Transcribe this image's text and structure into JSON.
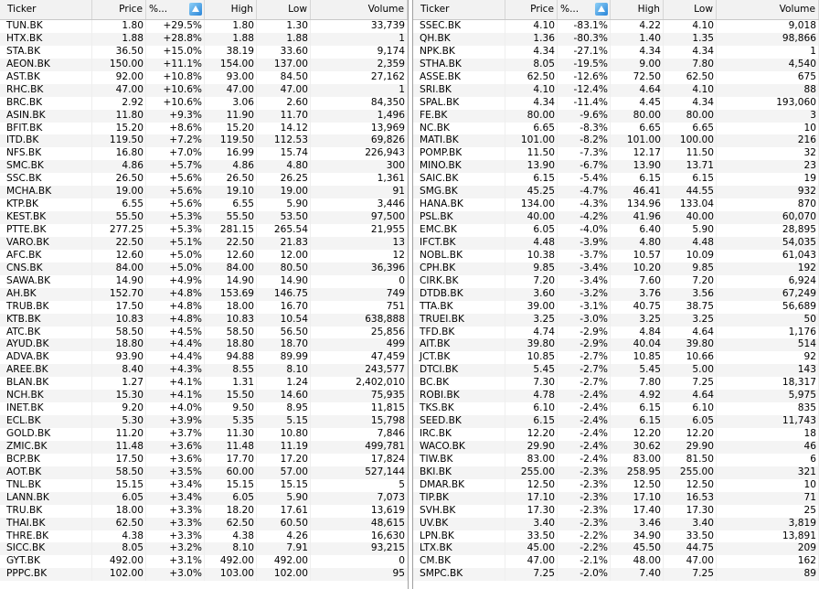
{
  "left": {
    "headers": [
      "Ticker",
      "Price",
      "%...",
      "High",
      "Low",
      "Volume"
    ],
    "rows": [
      [
        "TUN.BK",
        "1.80",
        "+29.5%",
        "1.80",
        "1.30",
        "33,739"
      ],
      [
        "HTX.BK",
        "1.88",
        "+28.8%",
        "1.88",
        "1.88",
        "1"
      ],
      [
        "STA.BK",
        "36.50",
        "+15.0%",
        "38.19",
        "33.60",
        "9,174"
      ],
      [
        "AEON.BK",
        "150.00",
        "+11.1%",
        "154.00",
        "137.00",
        "2,359"
      ],
      [
        "AST.BK",
        "92.00",
        "+10.8%",
        "93.00",
        "84.50",
        "27,162"
      ],
      [
        "RHC.BK",
        "47.00",
        "+10.6%",
        "47.00",
        "47.00",
        "1"
      ],
      [
        "BRC.BK",
        "2.92",
        "+10.6%",
        "3.06",
        "2.60",
        "84,350"
      ],
      [
        "ASIN.BK",
        "11.80",
        "+9.3%",
        "11.90",
        "11.70",
        "1,496"
      ],
      [
        "BFIT.BK",
        "15.20",
        "+8.6%",
        "15.20",
        "14.12",
        "13,969"
      ],
      [
        "ITD.BK",
        "119.50",
        "+7.2%",
        "119.50",
        "112.53",
        "69,826"
      ],
      [
        "NFS.BK",
        "16.80",
        "+7.0%",
        "16.99",
        "15.74",
        "226,943"
      ],
      [
        "SMC.BK",
        "4.86",
        "+5.7%",
        "4.86",
        "4.80",
        "300"
      ],
      [
        "SSC.BK",
        "26.50",
        "+5.6%",
        "26.50",
        "26.25",
        "1,361"
      ],
      [
        "MCHA.BK",
        "19.00",
        "+5.6%",
        "19.10",
        "19.00",
        "91"
      ],
      [
        "KTP.BK",
        "6.55",
        "+5.6%",
        "6.55",
        "5.90",
        "3,446"
      ],
      [
        "KEST.BK",
        "55.50",
        "+5.3%",
        "55.50",
        "53.50",
        "97,500"
      ],
      [
        "PTTE.BK",
        "277.25",
        "+5.3%",
        "281.15",
        "265.54",
        "21,955"
      ],
      [
        "VARO.BK",
        "22.50",
        "+5.1%",
        "22.50",
        "21.83",
        "13"
      ],
      [
        "AFC.BK",
        "12.60",
        "+5.0%",
        "12.60",
        "12.00",
        "12"
      ],
      [
        "CNS.BK",
        "84.00",
        "+5.0%",
        "84.00",
        "80.50",
        "36,396"
      ],
      [
        "SAWA.BK",
        "14.90",
        "+4.9%",
        "14.90",
        "14.90",
        "0"
      ],
      [
        "AH.BK",
        "152.70",
        "+4.8%",
        "153.69",
        "146.75",
        "749"
      ],
      [
        "TRUB.BK",
        "17.50",
        "+4.8%",
        "18.00",
        "16.70",
        "751"
      ],
      [
        "KTB.BK",
        "10.83",
        "+4.8%",
        "10.83",
        "10.54",
        "638,888"
      ],
      [
        "ATC.BK",
        "58.50",
        "+4.5%",
        "58.50",
        "56.50",
        "25,856"
      ],
      [
        "AYUD.BK",
        "18.80",
        "+4.4%",
        "18.80",
        "18.70",
        "499"
      ],
      [
        "ADVA.BK",
        "93.90",
        "+4.4%",
        "94.88",
        "89.99",
        "47,459"
      ],
      [
        "AREE.BK",
        "8.40",
        "+4.3%",
        "8.55",
        "8.10",
        "243,577"
      ],
      [
        "BLAN.BK",
        "1.27",
        "+4.1%",
        "1.31",
        "1.24",
        "2,402,010"
      ],
      [
        "NCH.BK",
        "15.30",
        "+4.1%",
        "15.50",
        "14.60",
        "75,935"
      ],
      [
        "INET.BK",
        "9.20",
        "+4.0%",
        "9.50",
        "8.95",
        "11,815"
      ],
      [
        "ECL.BK",
        "5.30",
        "+3.9%",
        "5.35",
        "5.15",
        "15,798"
      ],
      [
        "GOLD.BK",
        "11.20",
        "+3.7%",
        "11.30",
        "10.80",
        "7,846"
      ],
      [
        "ZMIC.BK",
        "11.48",
        "+3.6%",
        "11.48",
        "11.19",
        "499,781"
      ],
      [
        "BCP.BK",
        "17.50",
        "+3.6%",
        "17.70",
        "17.20",
        "17,824"
      ],
      [
        "AOT.BK",
        "58.50",
        "+3.5%",
        "60.00",
        "57.00",
        "527,144"
      ],
      [
        "TNL.BK",
        "15.15",
        "+3.4%",
        "15.15",
        "15.15",
        "5"
      ],
      [
        "LANN.BK",
        "6.05",
        "+3.4%",
        "6.05",
        "5.90",
        "7,073"
      ],
      [
        "TRU.BK",
        "18.00",
        "+3.3%",
        "18.20",
        "17.61",
        "13,619"
      ],
      [
        "THAI.BK",
        "62.50",
        "+3.3%",
        "62.50",
        "60.50",
        "48,615"
      ],
      [
        "THRE.BK",
        "4.38",
        "+3.3%",
        "4.38",
        "4.26",
        "16,630"
      ],
      [
        "SICC.BK",
        "8.05",
        "+3.2%",
        "8.10",
        "7.91",
        "93,215"
      ],
      [
        "GYT.BK",
        "492.00",
        "+3.1%",
        "492.00",
        "492.00",
        "0"
      ],
      [
        "PPPC.BK",
        "102.00",
        "+3.0%",
        "103.00",
        "102.00",
        "95"
      ]
    ]
  },
  "right": {
    "headers": [
      "Ticker",
      "Price",
      "%...",
      "High",
      "Low",
      "Volume"
    ],
    "rows": [
      [
        "SSEC.BK",
        "4.10",
        "-83.1%",
        "4.22",
        "4.10",
        "9,018"
      ],
      [
        "QH.BK",
        "1.36",
        "-80.3%",
        "1.40",
        "1.35",
        "98,866"
      ],
      [
        "NPK.BK",
        "4.34",
        "-27.1%",
        "4.34",
        "4.34",
        "1"
      ],
      [
        "STHA.BK",
        "8.05",
        "-19.5%",
        "9.00",
        "7.80",
        "4,540"
      ],
      [
        "ASSE.BK",
        "62.50",
        "-12.6%",
        "72.50",
        "62.50",
        "675"
      ],
      [
        "SRI.BK",
        "4.10",
        "-12.4%",
        "4.64",
        "4.10",
        "88"
      ],
      [
        "SPAL.BK",
        "4.34",
        "-11.4%",
        "4.45",
        "4.34",
        "193,060"
      ],
      [
        "FE.BK",
        "80.00",
        "-9.6%",
        "80.00",
        "80.00",
        "3"
      ],
      [
        "NC.BK",
        "6.65",
        "-8.3%",
        "6.65",
        "6.65",
        "10"
      ],
      [
        "MATI.BK",
        "101.00",
        "-8.2%",
        "101.00",
        "100.00",
        "216"
      ],
      [
        "POMP.BK",
        "11.50",
        "-7.3%",
        "12.17",
        "11.50",
        "32"
      ],
      [
        "MINO.BK",
        "13.90",
        "-6.7%",
        "13.90",
        "13.71",
        "23"
      ],
      [
        "SAIC.BK",
        "6.15",
        "-5.4%",
        "6.15",
        "6.15",
        "19"
      ],
      [
        "SMG.BK",
        "45.25",
        "-4.7%",
        "46.41",
        "44.55",
        "932"
      ],
      [
        "HANA.BK",
        "134.00",
        "-4.3%",
        "134.96",
        "133.04",
        "870"
      ],
      [
        "PSL.BK",
        "40.00",
        "-4.2%",
        "41.96",
        "40.00",
        "60,070"
      ],
      [
        "EMC.BK",
        "6.05",
        "-4.0%",
        "6.40",
        "5.90",
        "28,895"
      ],
      [
        "IFCT.BK",
        "4.48",
        "-3.9%",
        "4.80",
        "4.48",
        "54,035"
      ],
      [
        "NOBL.BK",
        "10.38",
        "-3.7%",
        "10.57",
        "10.09",
        "61,043"
      ],
      [
        "CPH.BK",
        "9.85",
        "-3.4%",
        "10.20",
        "9.85",
        "192"
      ],
      [
        "CIRK.BK",
        "7.20",
        "-3.4%",
        "7.60",
        "7.20",
        "6,924"
      ],
      [
        "DTDB.BK",
        "3.60",
        "-3.2%",
        "3.76",
        "3.56",
        "67,249"
      ],
      [
        "TTA.BK",
        "39.00",
        "-3.1%",
        "40.75",
        "38.75",
        "56,689"
      ],
      [
        "TRUEI.BK",
        "3.25",
        "-3.0%",
        "3.25",
        "3.25",
        "50"
      ],
      [
        "TFD.BK",
        "4.74",
        "-2.9%",
        "4.84",
        "4.64",
        "1,176"
      ],
      [
        "AIT.BK",
        "39.80",
        "-2.9%",
        "40.04",
        "39.80",
        "514"
      ],
      [
        "JCT.BK",
        "10.85",
        "-2.7%",
        "10.85",
        "10.66",
        "92"
      ],
      [
        "DTCI.BK",
        "5.45",
        "-2.7%",
        "5.45",
        "5.00",
        "143"
      ],
      [
        "BC.BK",
        "7.30",
        "-2.7%",
        "7.80",
        "7.25",
        "18,317"
      ],
      [
        "ROBI.BK",
        "4.78",
        "-2.4%",
        "4.92",
        "4.64",
        "5,975"
      ],
      [
        "TKS.BK",
        "6.10",
        "-2.4%",
        "6.15",
        "6.10",
        "835"
      ],
      [
        "SEED.BK",
        "6.15",
        "-2.4%",
        "6.15",
        "6.05",
        "11,743"
      ],
      [
        "IRC.BK",
        "12.20",
        "-2.4%",
        "12.20",
        "12.20",
        "18"
      ],
      [
        "WACO.BK",
        "29.90",
        "-2.4%",
        "30.62",
        "29.90",
        "46"
      ],
      [
        "TIW.BK",
        "83.00",
        "-2.4%",
        "83.00",
        "81.50",
        "6"
      ],
      [
        "BKI.BK",
        "255.00",
        "-2.3%",
        "258.95",
        "255.00",
        "321"
      ],
      [
        "DMAR.BK",
        "12.50",
        "-2.3%",
        "12.50",
        "12.50",
        "10"
      ],
      [
        "TIP.BK",
        "17.10",
        "-2.3%",
        "17.10",
        "16.53",
        "71"
      ],
      [
        "SVH.BK",
        "17.30",
        "-2.3%",
        "17.40",
        "17.30",
        "25"
      ],
      [
        "UV.BK",
        "3.40",
        "-2.3%",
        "3.46",
        "3.40",
        "3,819"
      ],
      [
        "LPN.BK",
        "33.50",
        "-2.2%",
        "34.90",
        "33.50",
        "13,891"
      ],
      [
        "LTX.BK",
        "45.00",
        "-2.2%",
        "45.50",
        "44.75",
        "209"
      ],
      [
        "CM.BK",
        "47.00",
        "-2.1%",
        "48.00",
        "47.00",
        "162"
      ],
      [
        "SMPC.BK",
        "7.25",
        "-2.0%",
        "7.40",
        "7.25",
        "89"
      ]
    ]
  },
  "icons": {
    "sort": "sort-descending-icon"
  },
  "colors": {
    "header_bg": "#f2f2f2",
    "alt_row": "#f4f4f4",
    "sort_icon": "#2a86d8"
  }
}
